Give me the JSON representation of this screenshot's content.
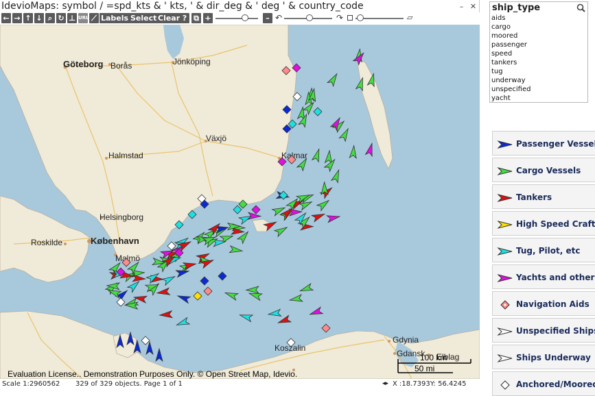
{
  "map": {
    "title": "IdevioMaps: symbol /  =spd_kts & ' kts, ' & dir_deg & ' deg ' & country_code",
    "window_buttons": {
      "minimize": "–",
      "close": "✕"
    },
    "toolbar": {
      "url_label": "URL",
      "labels_label": "Labels",
      "select_label": "Select",
      "clear_label": "Clear",
      "help_label": "?",
      "plus_label": "+",
      "minus_label": "–"
    },
    "places": [
      "Göteborg",
      "Borås",
      "Jönköping",
      "Växjö",
      "Halmstad",
      "Kalmar",
      "Helsingborg",
      "København",
      "Roskilde",
      "Malmö",
      "Gdynia",
      "Gdansk",
      "Elblag",
      "Koszalin"
    ],
    "scalebar": {
      "km": "100 km",
      "mi": "50 mi"
    },
    "license": "Evaluation License.. Demonstration Purposes Only. © Open Street Map, Idevio.",
    "footer": {
      "scale": "Scale 1:2960562",
      "objects": "329 of 329 objects. Page 1 of 1",
      "coords": "X :18.7393Y: 56.4245"
    }
  },
  "ship_type_list": {
    "title": "ship_type",
    "items": [
      "aids",
      "cargo",
      "moored",
      "passenger",
      "speed",
      "tankers",
      "tug",
      "underway",
      "unspecified",
      "yacht"
    ]
  },
  "legend": [
    {
      "label": "Passenger Vessels",
      "icon": "arrow",
      "color": "#0a2ad6"
    },
    {
      "label": "Cargo Vessels",
      "icon": "arrow",
      "color": "#44dd44"
    },
    {
      "label": "Tankers",
      "icon": "arrow",
      "color": "#e01010"
    },
    {
      "label": "High Speed Craft",
      "icon": "arrow",
      "color": "#ffe000"
    },
    {
      "label": "Tug, Pilot, etc",
      "icon": "arrow",
      "color": "#1ee0e0"
    },
    {
      "label": "Yachts and others",
      "icon": "arrow",
      "color": "#e010e0"
    },
    {
      "label": "Navigation Aids",
      "icon": "diamond",
      "color": "#ff8a8a"
    },
    {
      "label": "Unspecified Ships",
      "icon": "arrow",
      "color": "#ffffff"
    },
    {
      "label": "Ships Underway",
      "icon": "arrow",
      "color": "#ffffff"
    },
    {
      "label": "Anchored/Moored",
      "icon": "diamond",
      "color": "#ffffff"
    }
  ]
}
